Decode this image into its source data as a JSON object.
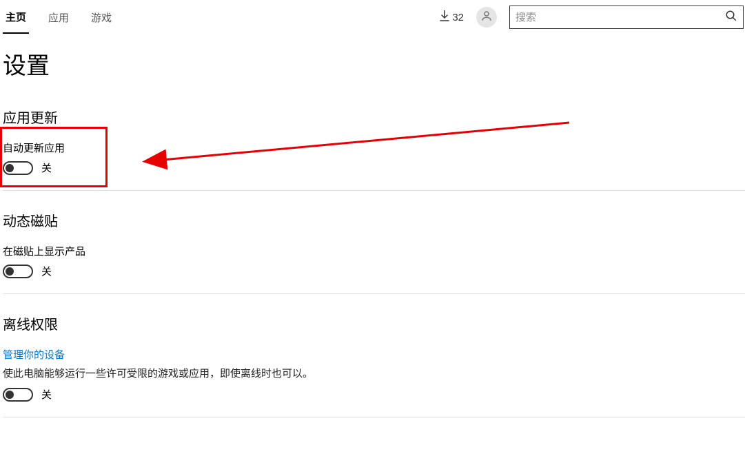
{
  "topbar": {
    "tabs": [
      {
        "label": "主页",
        "active": true
      },
      {
        "label": "应用",
        "active": false
      },
      {
        "label": "游戏",
        "active": false
      }
    ],
    "downloads_count": "32",
    "search_placeholder": "搜索"
  },
  "page": {
    "title": "设置"
  },
  "sections": {
    "app_update": {
      "title": "应用更新",
      "setting_label": "自动更新应用",
      "toggle_state": "关"
    },
    "live_tile": {
      "title": "动态磁贴",
      "setting_label": "在磁贴上显示产品",
      "toggle_state": "关"
    },
    "offline": {
      "title": "离线权限",
      "link": "管理你的设备",
      "desc": "使此电脑能够运行一些许可受限的游戏或应用，即使离线时也可以。",
      "toggle_state": "关"
    }
  }
}
